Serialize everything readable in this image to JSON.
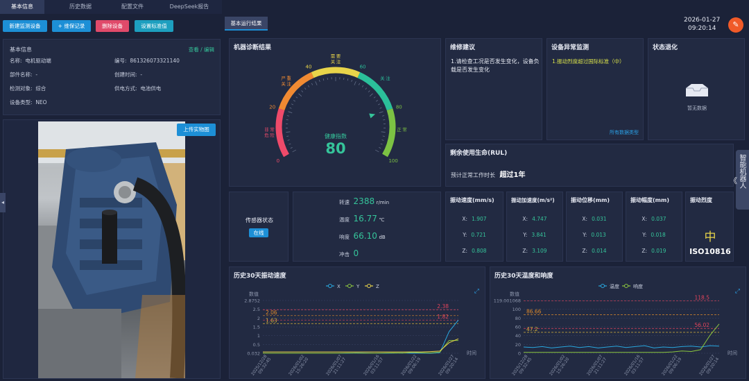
{
  "tabs": [
    "基本信息",
    "历史数据",
    "配置文件",
    "DeepSeek报告"
  ],
  "datetime": {
    "date": "2026-01-27",
    "time": "09:20:14"
  },
  "buttons": {
    "new_device": "新建监测设备",
    "maintenance": "+ 维保记录",
    "delete_device": "删除设备",
    "set_standard": "设置标准值",
    "upload_photo": "上传实物图"
  },
  "basic_info": {
    "title": "基本信息",
    "edit_link": "查看 / 编辑",
    "fields": [
      {
        "label": "名称:",
        "value": "电机驱动端"
      },
      {
        "label": "编号:",
        "value": "861326073321140"
      },
      {
        "label": "部件名称:",
        "value": "-"
      },
      {
        "label": "创建时间:",
        "value": "-"
      },
      {
        "label": "检测对象:",
        "value": "综合"
      },
      {
        "label": "供电方式:",
        "value": "电池供电"
      },
      {
        "label": "设备类型:",
        "value": "NEO"
      }
    ]
  },
  "results_tab": "基本运行结果",
  "diagnosis": {
    "title": "机器诊断结果",
    "gauge_label": "健康指数",
    "health_value": "80",
    "health_fraction": 0.8,
    "ticks": [
      "0",
      "20",
      "40",
      "60",
      "80",
      "100"
    ],
    "zones": [
      "非常危险",
      "严重关注",
      "需要关注",
      "关注",
      "正常"
    ],
    "zone_colors": [
      "#ef4a6a",
      "#f08a32",
      "#e8d44a",
      "#2bbf9a",
      "#7cc243"
    ]
  },
  "maintenance_advice": {
    "title": "维修建议",
    "text": "1.请检查工况是否发生变化，设备负载是否发生变化"
  },
  "anomaly": {
    "title": "设备异常监测",
    "text": "1.振动烈度超过国际标准（中）",
    "link": "所有数据类型"
  },
  "degradation": {
    "title": "状态退化",
    "empty": "暂无数据"
  },
  "rul": {
    "title": "剩余使用生命(RUL)",
    "label": "预计正常工作时长",
    "value": "超过1年"
  },
  "side_robot": "智能机器人",
  "sensor": {
    "label": "传感器状态",
    "status": "在线"
  },
  "readings": [
    {
      "label": "转速",
      "value": "2388",
      "unit": "r/min"
    },
    {
      "label": "温度",
      "value": "16.77",
      "unit": "℃"
    },
    {
      "label": "响度",
      "value": "66.10",
      "unit": "dB"
    },
    {
      "label": "冲击",
      "value": "0",
      "unit": ""
    }
  ],
  "vibration": [
    {
      "title": "振动速度(mm/s)",
      "x": "1.907",
      "y": "0.721",
      "z": "0.808"
    },
    {
      "title": "振动加速度(m/s²)",
      "x": "4.747",
      "y": "3.841",
      "z": "3.109"
    },
    {
      "title": "振动位移(mm)",
      "x": "0.031",
      "y": "0.013",
      "z": "0.014"
    },
    {
      "title": "振动幅度(mm)",
      "x": "0.037",
      "y": "0.018",
      "z": "0.019"
    }
  ],
  "severity": {
    "title": "振动烈度",
    "level": "中",
    "standard": "ISO10816"
  },
  "chart_data": [
    {
      "type": "line",
      "title": "历史30天振动速度",
      "ylabel": "数值",
      "xlabel": "时间",
      "yticks": [
        "2.8752",
        "2.5",
        "2",
        "1.5",
        "1",
        "0.5",
        "0.032"
      ],
      "ylim": [
        0.032,
        2.8752
      ],
      "x": [
        "2025/12/28 09:32:45",
        "2026/01/02 15:26:20",
        "2026/01/07 21:11:27",
        "2026/01/16 03:11:57",
        "2026/01/22 09:06:19",
        "2026/01/27 09:20:14"
      ],
      "thresholds": [
        {
          "value": 2.38,
          "label": "2.38",
          "color": "#e2445c"
        },
        {
          "value": 2.06,
          "label": "2.06",
          "color": "#e08a2a"
        },
        {
          "value": 1.63,
          "label": "1.63",
          "color": "#d8b23a"
        },
        {
          "value": 1.82,
          "label": "1.82",
          "color": "#e2445c"
        }
      ],
      "series": [
        {
          "name": "X",
          "color": "#29a8e0",
          "values": [
            0.03,
            0.03,
            0.03,
            0.03,
            0.03,
            0.03,
            0.03,
            0.03,
            0.03,
            0.03,
            0.05,
            0.04,
            0.03,
            0.03,
            0.04,
            0.05,
            0.03,
            0.04,
            0.03,
            0.06,
            1.2,
            1.82
          ]
        },
        {
          "name": "Y",
          "color": "#8cc63e",
          "values": [
            0.03,
            0.03,
            0.03,
            0.03,
            0.03,
            0.03,
            0.03,
            0.03,
            0.03,
            0.04,
            0.04,
            0.03,
            0.03,
            0.04,
            0.05,
            0.04,
            0.08,
            0.06,
            0.05,
            0.09,
            0.72,
            0.72
          ]
        },
        {
          "name": "Z",
          "color": "#e8d44a",
          "values": [
            0.1,
            0.1,
            0.1,
            0.1,
            0.1,
            0.1,
            0.1,
            0.1,
            0.1,
            0.1,
            0.1,
            0.1,
            0.1,
            0.1,
            0.1,
            0.1,
            0.1,
            0.1,
            0.12,
            0.15,
            0.6,
            0.81
          ]
        }
      ]
    },
    {
      "type": "line",
      "title": "历史30天温度和响度",
      "ylabel": "数值",
      "xlabel": "时间",
      "yticks": [
        "119.001068",
        "100",
        "80",
        "60",
        "40",
        "20",
        "0"
      ],
      "ylim": [
        0,
        119.001068
      ],
      "x": [
        "2025/12/28 09:32:45",
        "2026/01/02 15:26:20",
        "2026/01/07 21:11:27",
        "2026/01/16 03:11:57",
        "2026/01/22 09:06:19",
        "2026/01/27 09:20:14"
      ],
      "thresholds": [
        {
          "value": 118.5,
          "label": "118.5",
          "color": "#e2445c"
        },
        {
          "value": 86.66,
          "label": "86.66",
          "color": "#e08a2a"
        },
        {
          "value": 47.2,
          "label": "47.2",
          "color": "#d8b23a"
        },
        {
          "value": 56.02,
          "label": "56.02",
          "color": "#e2445c"
        }
      ],
      "series": [
        {
          "name": "温度",
          "color": "#29a8e0",
          "values": [
            14,
            13,
            15,
            12,
            14,
            16,
            13,
            15,
            12,
            14,
            16,
            13,
            15,
            17,
            12,
            14,
            13,
            15,
            16,
            14,
            17,
            16
          ]
        },
        {
          "name": "响度",
          "color": "#8cc63e",
          "values": [
            2,
            2,
            2,
            2,
            2,
            2,
            2,
            2,
            2,
            2,
            2,
            2,
            2,
            2,
            2,
            2,
            3,
            5,
            4,
            8,
            40,
            66
          ]
        }
      ]
    }
  ]
}
